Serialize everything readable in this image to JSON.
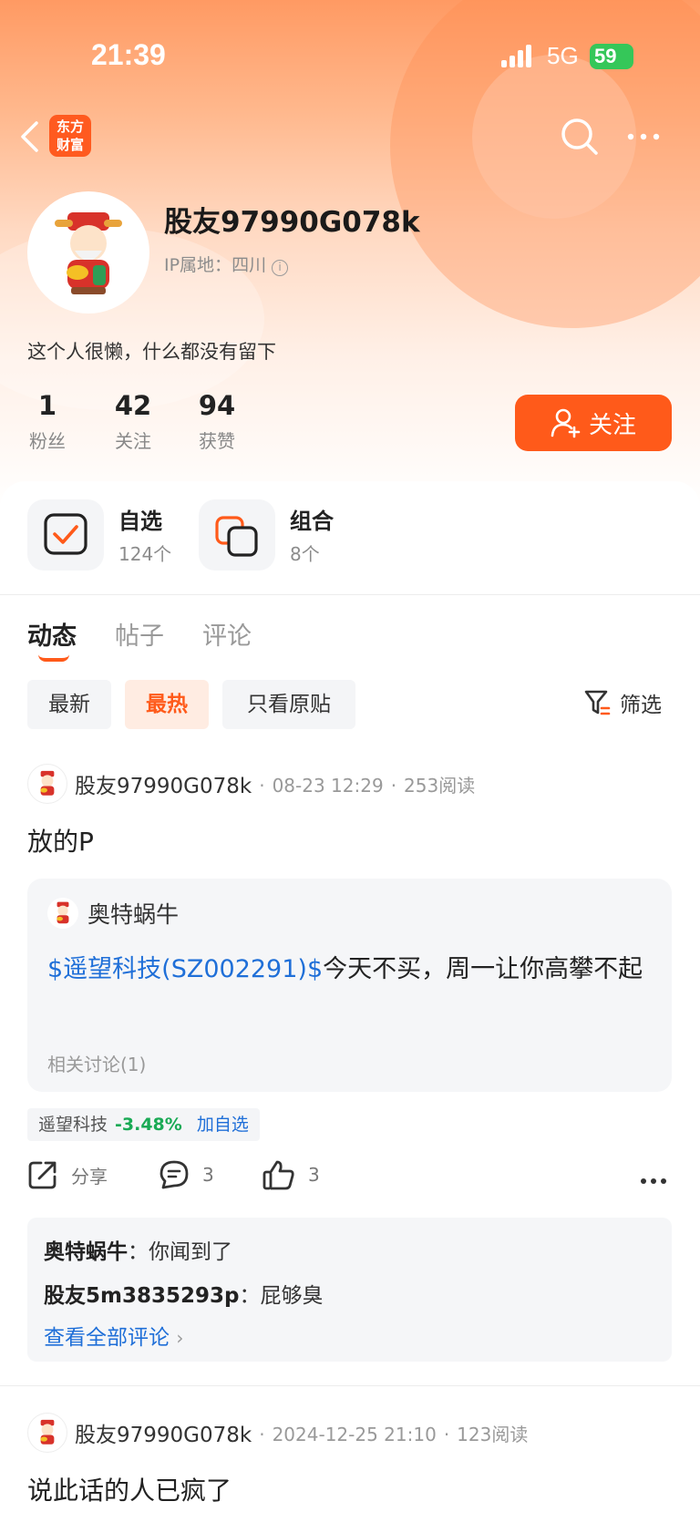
{
  "status_bar": {
    "time": "21:39",
    "network": "5G",
    "battery": "59"
  },
  "nav": {
    "logo_text": "东方财富"
  },
  "profile": {
    "username": "股友97990G078k",
    "ip_label": "IP属地：",
    "ip_location": "四川",
    "bio": "这个人很懒，什么都没有留下",
    "stats": [
      {
        "value": "1",
        "label": "粉丝"
      },
      {
        "value": "42",
        "label": "关注"
      },
      {
        "value": "94",
        "label": "获赞"
      }
    ],
    "follow_label": "关注"
  },
  "quick_entries": [
    {
      "title": "自选",
      "subtitle": "124个"
    },
    {
      "title": "组合",
      "subtitle": "8个"
    }
  ],
  "tabs": [
    "动态",
    "帖子",
    "评论"
  ],
  "filters": {
    "chips": [
      "最新",
      "最热",
      "只看原贴"
    ],
    "active": "最热",
    "filter_label": "筛选"
  },
  "posts": [
    {
      "author": "股友97990G078k",
      "date": "08-23 12:29",
      "reads": "253阅读",
      "text": "放的P",
      "quote": {
        "author": "奥特蜗牛",
        "stock_link": "$遥望科技(SZ002291)$",
        "body": "今天不买，周一让你高攀不起",
        "related": "相关讨论(1)"
      },
      "stock_tag": {
        "name": "遥望科技",
        "change": "-3.48%",
        "add_label": "加自选"
      },
      "actions": {
        "share": "分享",
        "comments": "3",
        "likes": "3"
      },
      "comments": [
        {
          "name": "奥特蜗牛",
          "text": "你闻到了"
        },
        {
          "name": "股友5m3835293p",
          "text": "屁够臭"
        }
      ],
      "view_all": "查看全部评论"
    },
    {
      "author": "股友97990G078k",
      "date": "2024-12-25 21:10",
      "reads": "123阅读",
      "text": "说此话的人已疯了"
    }
  ],
  "colors": {
    "accent": "#ff5a1a",
    "link": "#1f6fd8",
    "down": "#1aaa55"
  }
}
